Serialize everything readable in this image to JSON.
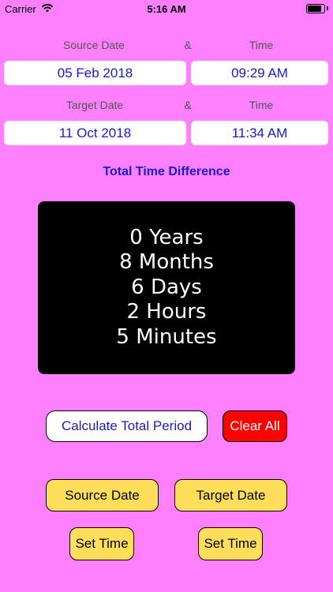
{
  "status_bar": {
    "carrier": "Carrier",
    "time": "5:16 AM",
    "battery_level": 0.85
  },
  "source": {
    "date_label": "Source Date",
    "amp": "&",
    "time_label": "Time",
    "date_value": "05 Feb 2018",
    "time_value": "09:29 AM"
  },
  "target": {
    "date_label": "Target Date",
    "amp": "&",
    "time_label": "Time",
    "date_value": "11 Oct 2018",
    "time_value": "11:34 AM"
  },
  "difference": {
    "title": "Total Time Difference",
    "lines": [
      "0 Years",
      "8 Months",
      "6 Days",
      "2 Hours",
      "5 Minutes"
    ]
  },
  "buttons": {
    "calculate": "Calculate Total Period",
    "clear": "Clear All",
    "source_date": "Source Date",
    "target_date": "Target Date",
    "set_time_source": "Set Time",
    "set_time_target": "Set Time"
  },
  "colors": {
    "background": "#ff80ff",
    "accent_text": "#1a1ac8",
    "clear_button": "#ff0000",
    "action_button": "#ffde5a",
    "result_background": "#000000"
  },
  "icons": {
    "wifi": "wifi-icon",
    "battery": "battery-icon"
  }
}
